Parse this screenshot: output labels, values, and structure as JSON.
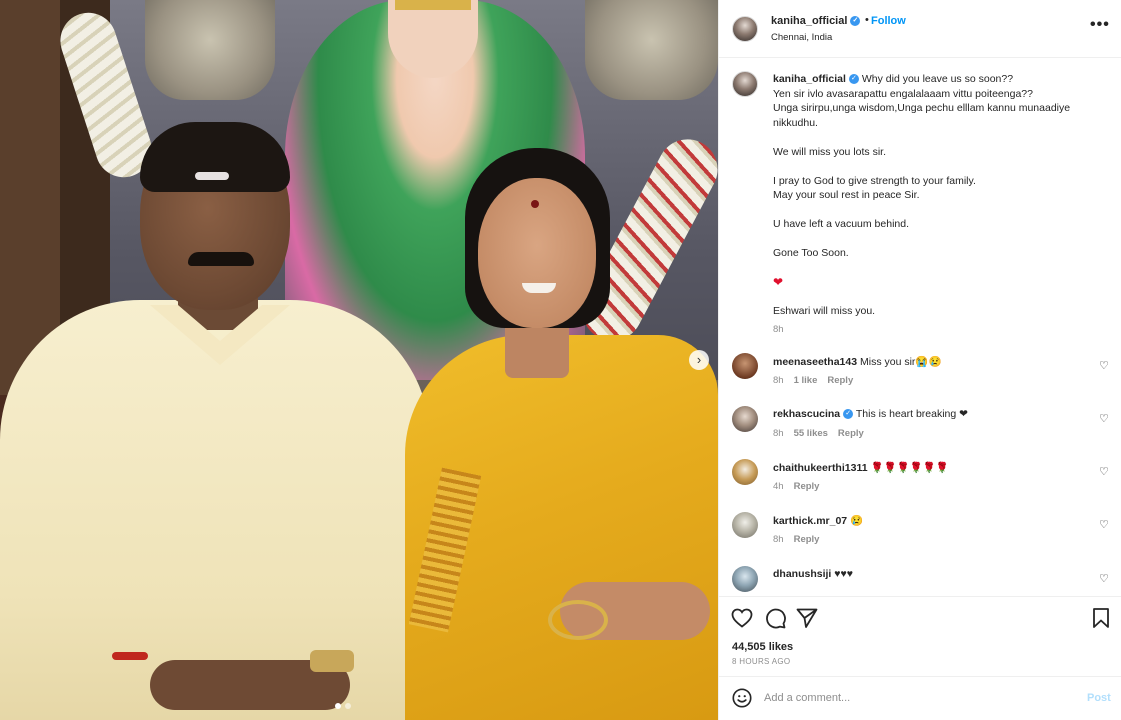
{
  "post": {
    "username": "kaniha_official",
    "follow_label": "Follow",
    "separator": "•",
    "location": "Chennai, India",
    "more_label": "•••",
    "carousel_next": "›"
  },
  "caption": {
    "username": "kaniha_official",
    "lines": [
      "Why did you leave us so soon??",
      "Yen sir ivlo avasarapattu engalalaaam vittu poiteenga??",
      "Unga sirirpu,unga wisdom,Unga pechu elllam kannu munaadiye nikkudhu.",
      "We will miss you lots sir.",
      "I pray to God to give strength to your family.",
      "May your soul rest in peace Sir.",
      "U have left a vacuum behind.",
      "Gone Too Soon.",
      "❤",
      "Eshwari will miss you."
    ],
    "time": "8h"
  },
  "comments": [
    {
      "username": "meenaseetha143",
      "text": "Miss you sir😭😢",
      "time": "8h",
      "likes": "1 like",
      "reply": "Reply",
      "verified": false
    },
    {
      "username": "rekhascucina",
      "text": "This is heart breaking ❤",
      "time": "8h",
      "likes": "55 likes",
      "reply": "Reply",
      "verified": true
    },
    {
      "username": "chaithukeerthi1311",
      "text": "🌹🌹🌹🌹🌹🌹",
      "time": "4h",
      "likes": "",
      "reply": "Reply",
      "verified": false
    },
    {
      "username": "karthick.mr_07",
      "text": "😢",
      "time": "8h",
      "likes": "",
      "reply": "Reply",
      "verified": false
    },
    {
      "username": "dhanushsiji",
      "text": "♥♥♥",
      "time": "",
      "likes": "",
      "reply": "",
      "verified": false
    }
  ],
  "stats": {
    "likes": "44,505 likes",
    "age": "8 HOURS AGO"
  },
  "composer": {
    "placeholder": "Add a comment...",
    "post_label": "Post"
  },
  "colors": {
    "accent": "#0095f6",
    "verified": "#3897f0",
    "muted": "#8e8e8e",
    "post_disabled": "#b2dffc"
  },
  "icons": {
    "like": "heart-outline-icon",
    "comment": "comment-bubble-icon",
    "share": "paper-plane-icon",
    "save": "bookmark-icon",
    "emoji": "smiley-icon",
    "more": "ellipsis-icon"
  }
}
